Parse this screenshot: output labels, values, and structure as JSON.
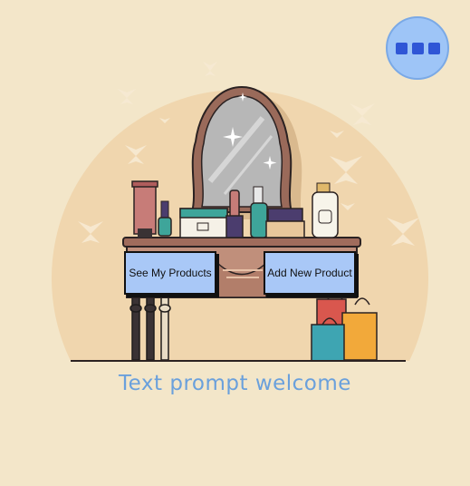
{
  "welcome_text": "Text prompt welcome",
  "buttons": {
    "see_products": "See My Products",
    "add_product": "Add New Product"
  },
  "menu": {
    "icon": "more-dots-icon"
  },
  "colors": {
    "background": "#f3e6c9",
    "circle": "#f0d6ae",
    "button": "#a9c8f7",
    "text_accent": "#6aa0dc",
    "menu": "#9ec5f7"
  }
}
